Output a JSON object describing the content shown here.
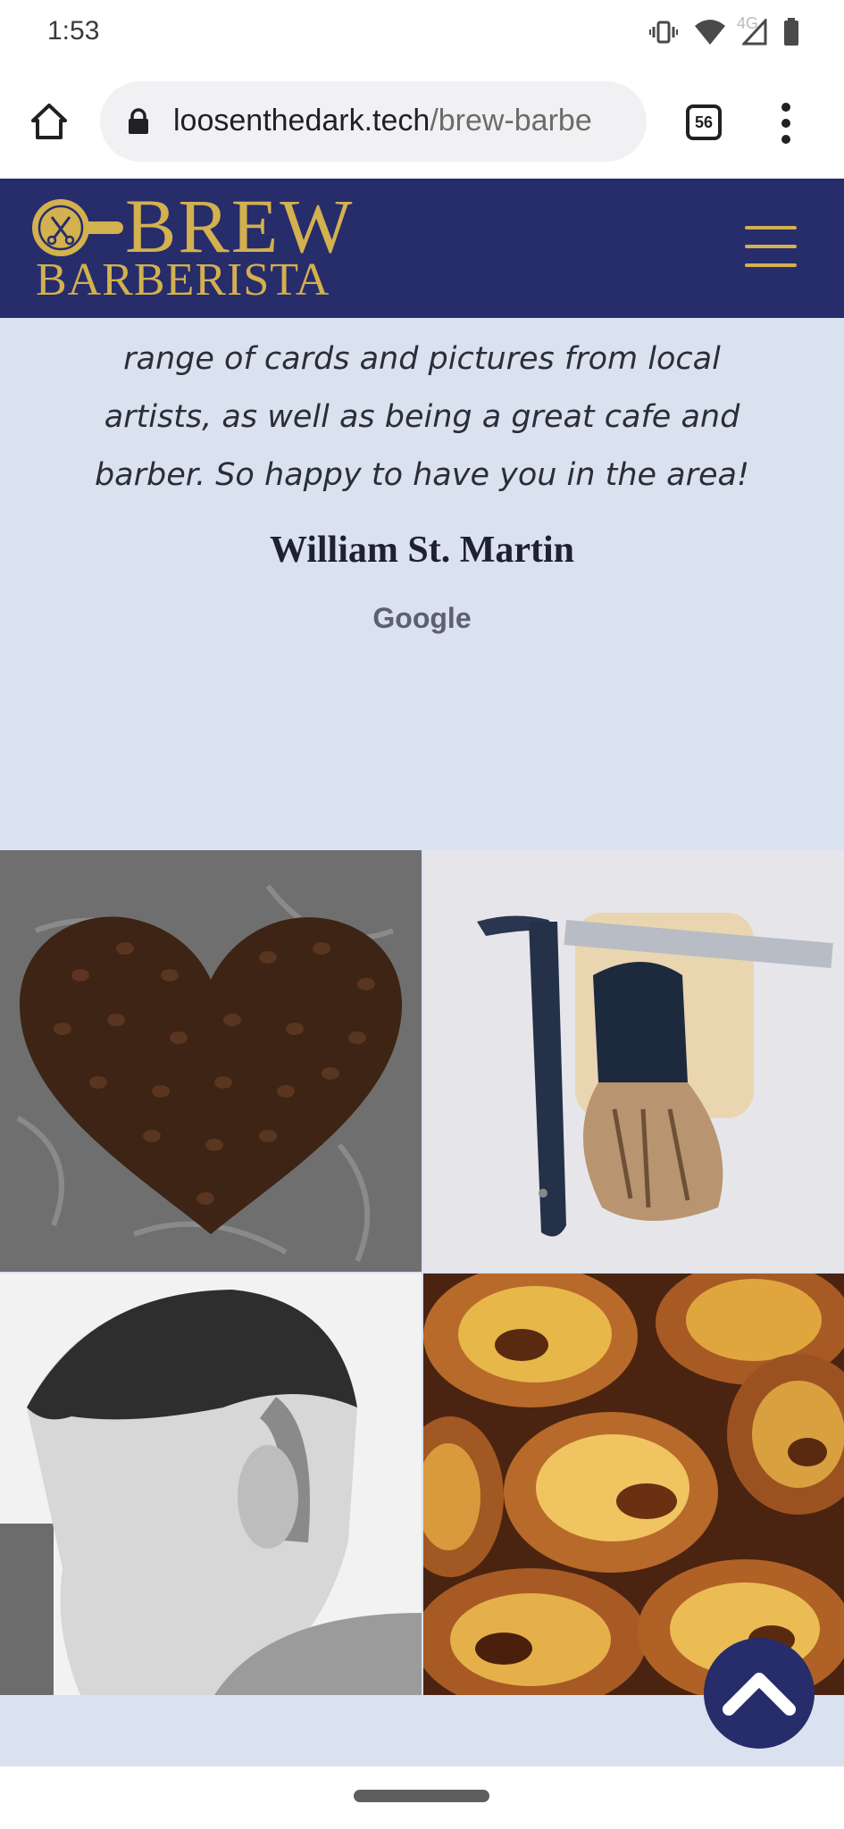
{
  "status_bar": {
    "time": "1:53",
    "network": "4G",
    "icons": [
      "vibrate-icon",
      "wifi-icon",
      "cell-signal-icon",
      "battery-icon"
    ]
  },
  "browser": {
    "url_domain": "loosenthedark.tech",
    "url_path": "/brew-barbe",
    "tab_count": "56",
    "icons": [
      "home-icon",
      "lock-icon",
      "tabs-icon",
      "overflow-menu-icon"
    ]
  },
  "site": {
    "logo_brew": "BREW",
    "logo_barberista": "BARBERISTA",
    "colors": {
      "header_bg": "#272c6b",
      "gold": "#d2b14e",
      "section_bg": "#dbe2ef"
    }
  },
  "review": {
    "quote_lines": [
      "range of cards and pictures from local",
      "artists, as well as being a great cafe and",
      "barber. So happy to have you in the area!"
    ],
    "author": "William St. Martin",
    "source": "Google"
  },
  "gallery": {
    "images": [
      "coffee-beans-heart-image",
      "straight-razor-shaving-brush-image",
      "boy-haircut-image",
      "custard-tarts-image"
    ]
  },
  "scroll_top": {
    "icon": "chevron-up-icon"
  }
}
